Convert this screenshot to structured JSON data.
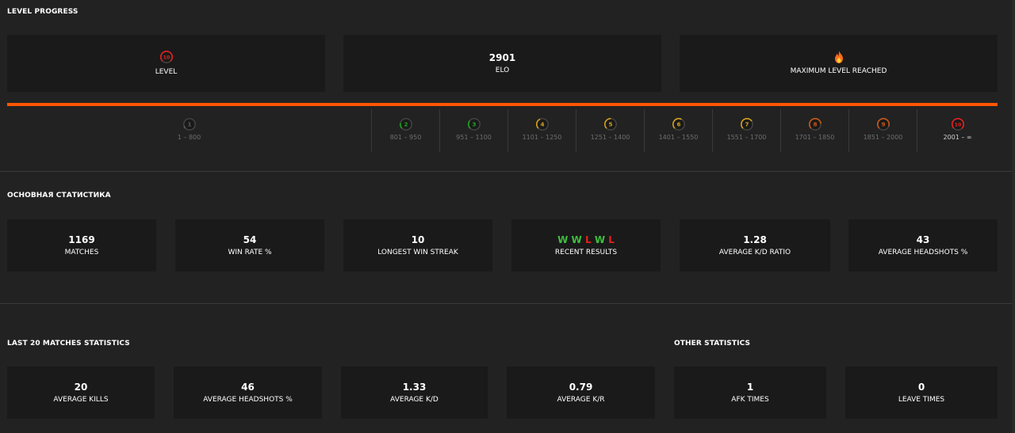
{
  "level_progress": {
    "title": "LEVEL PROGRESS",
    "level": {
      "value": "10",
      "label": "LEVEL"
    },
    "elo": {
      "value": "2901",
      "label": "ELO"
    },
    "max": {
      "icon": "fire-icon",
      "label": "MAXIMUM LEVEL REACHED"
    },
    "bar_color": "#ff5500",
    "levels": [
      {
        "num": "1",
        "range": "1 – 800",
        "color": "#5a5a5a"
      },
      {
        "num": "2",
        "range": "801 – 950",
        "color": "#1ea51e"
      },
      {
        "num": "3",
        "range": "951 – 1100",
        "color": "#1ea51e"
      },
      {
        "num": "4",
        "range": "1101 – 1250",
        "color": "#d4a11a"
      },
      {
        "num": "5",
        "range": "1251 – 1400",
        "color": "#d4a11a"
      },
      {
        "num": "6",
        "range": "1401 – 1550",
        "color": "#d4a11a"
      },
      {
        "num": "7",
        "range": "1551 – 1700",
        "color": "#d4a11a"
      },
      {
        "num": "8",
        "range": "1701 – 1850",
        "color": "#c8581b"
      },
      {
        "num": "9",
        "range": "1851 – 2000",
        "color": "#c8581b"
      },
      {
        "num": "10",
        "range": "2001 – ∞",
        "color": "#e3221f"
      }
    ]
  },
  "main_stats": {
    "title": "ОСНОВНАЯ СТАТИСТИКА",
    "matches": {
      "value": "1169",
      "label": "MATCHES"
    },
    "win_rate": {
      "value": "54",
      "label": "WIN RATE %"
    },
    "streak": {
      "value": "10",
      "label": "LONGEST WIN STREAK"
    },
    "recent": {
      "label": "RECENT RESULTS",
      "results": [
        "W",
        "W",
        "L",
        "W",
        "L"
      ],
      "win_color": "#3fbf3f",
      "loss_color": "#e3221f"
    },
    "kd": {
      "value": "1.28",
      "label": "AVERAGE K/D RATIO"
    },
    "hs": {
      "value": "43",
      "label": "AVERAGE HEADSHOTS %"
    }
  },
  "last20": {
    "title": "LAST 20 MATCHES STATISTICS",
    "kills": {
      "value": "20",
      "label": "AVERAGE KILLS"
    },
    "hs": {
      "value": "46",
      "label": "AVERAGE HEADSHOTS %"
    },
    "kd": {
      "value": "1.33",
      "label": "AVERAGE K/D"
    },
    "kr": {
      "value": "0.79",
      "label": "AVERAGE K/R"
    }
  },
  "other": {
    "title": "OTHER STATISTICS",
    "afk": {
      "value": "1",
      "label": "AFK TIMES"
    },
    "leave": {
      "value": "0",
      "label": "LEAVE TIMES"
    }
  }
}
